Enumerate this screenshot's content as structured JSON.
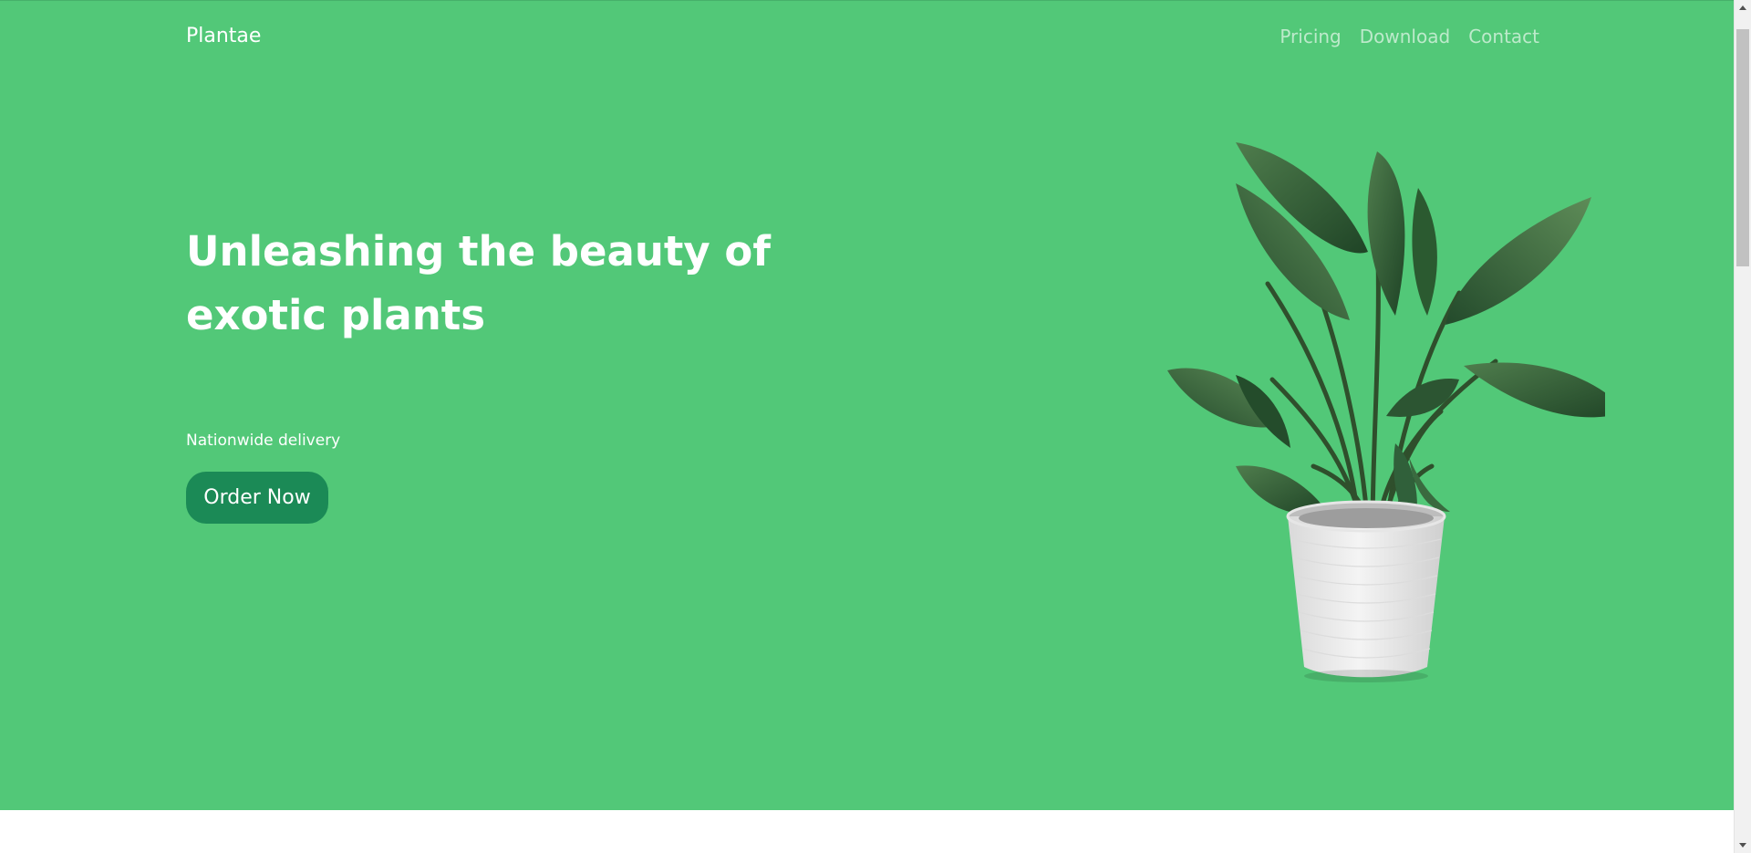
{
  "brand": {
    "name": "Plantae"
  },
  "nav": {
    "items": [
      {
        "label": "Pricing"
      },
      {
        "label": "Download"
      },
      {
        "label": "Contact"
      }
    ]
  },
  "hero": {
    "headline": "Unleashing the beauty of exotic plants",
    "subtext": "Nationwide delivery",
    "cta_label": "Order Now",
    "image_icon": "potted-plant-icon"
  },
  "colors": {
    "hero_background": "#52c878",
    "button_background": "#1b8a56",
    "text": "#ffffff"
  }
}
